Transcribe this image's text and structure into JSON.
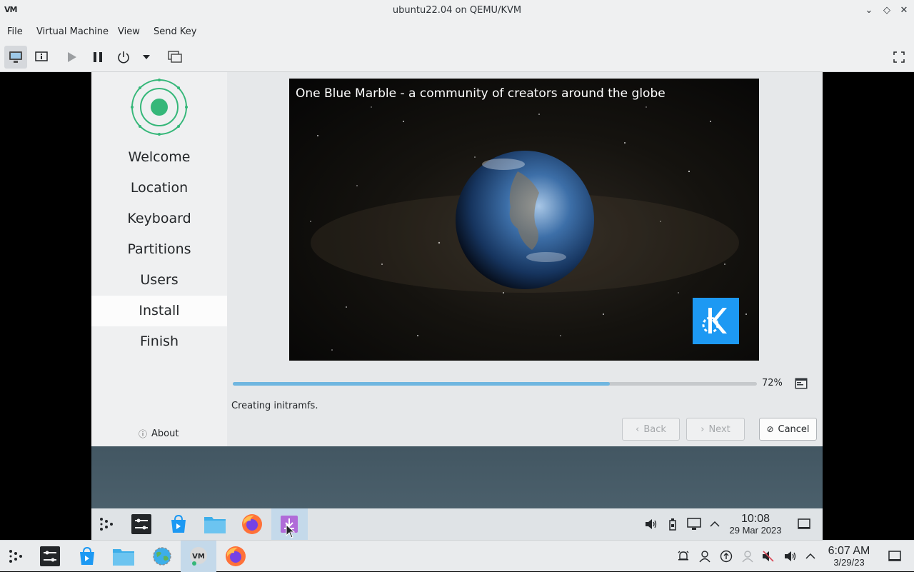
{
  "window": {
    "title": "ubuntu22.04 on QEMU/KVM",
    "app_logo": "VM",
    "minimize_glyph": "⌄",
    "maximize_glyph": "◇",
    "close_glyph": "✕"
  },
  "menu": [
    "File",
    "Virtual Machine",
    "View",
    "Send Key"
  ],
  "toolbar": {
    "buttons": [
      "monitor-icon",
      "details-icon",
      "play-icon",
      "pause-icon",
      "power-icon",
      "dropdown-icon",
      "snapshots-icon",
      "fullscreen-icon"
    ]
  },
  "installer": {
    "steps": [
      "Welcome",
      "Location",
      "Keyboard",
      "Partitions",
      "Users",
      "Install",
      "Finish"
    ],
    "current_step": "Install",
    "about": "About",
    "slide_caption": "One Blue Marble - a community of creators around the globe",
    "progress": 72,
    "progress_label": "72%",
    "status": "Creating initramfs.",
    "buttons": {
      "back": "Back",
      "next": "Next",
      "cancel": "Cancel"
    }
  },
  "vm_taskbar": {
    "clock_time": "10:08",
    "clock_date": "29 Mar 2023"
  },
  "host_taskbar": {
    "clock_time": "6:07 AM",
    "clock_date": "3/29/23"
  },
  "colors": {
    "accent": "#3daee9",
    "progress": "#6fb6e0",
    "kde_blue": "#1d99f3",
    "calamares_green": "#35b779"
  }
}
